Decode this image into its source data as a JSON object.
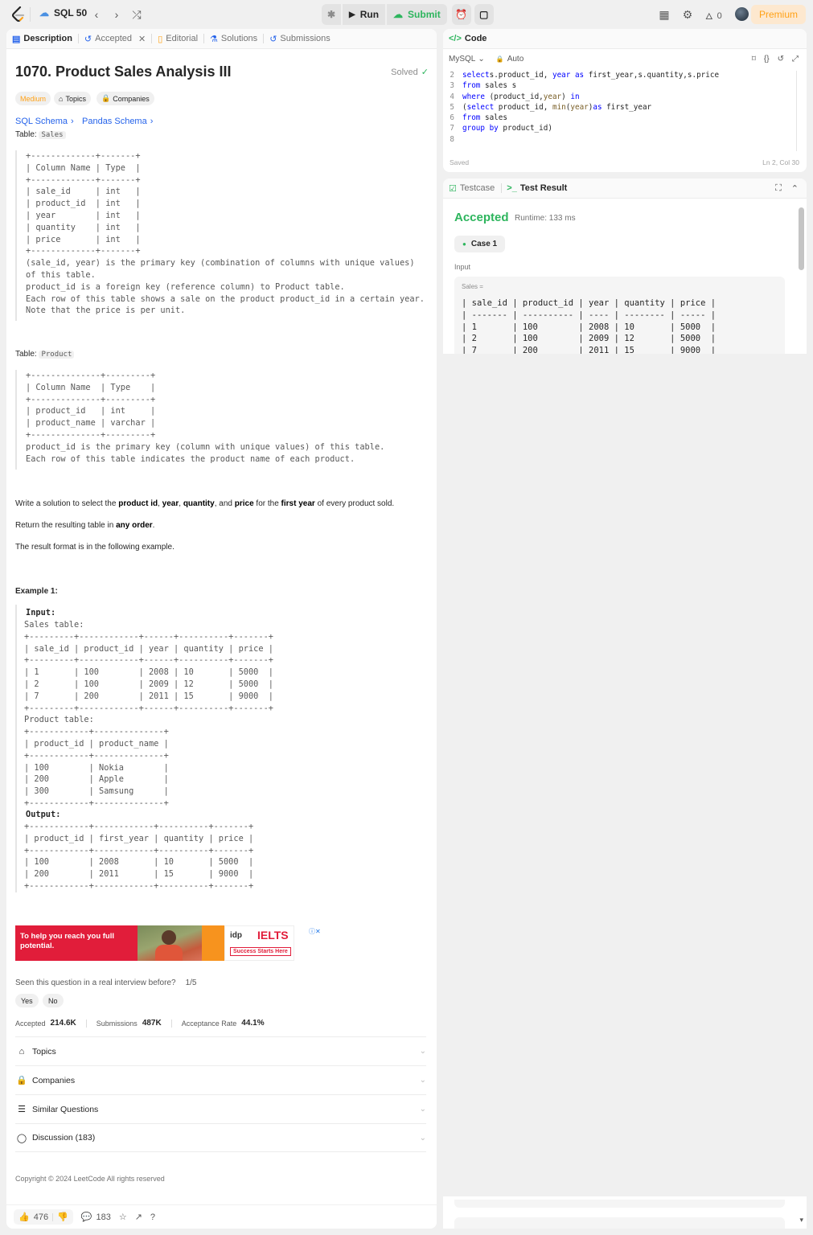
{
  "topbar": {
    "study_plan": "SQL 50",
    "run": "Run",
    "submit": "Submit",
    "streak": "0",
    "premium": "Premium"
  },
  "left_tabs": {
    "description": "Description",
    "accepted": "Accepted",
    "editorial": "Editorial",
    "solutions": "Solutions",
    "submissions": "Submissions"
  },
  "problem": {
    "title": "1070. Product Sales Analysis III",
    "solved": "Solved",
    "difficulty": "Medium",
    "topics_chip": "Topics",
    "companies_chip": "Companies",
    "sql_schema": "SQL Schema",
    "pandas_schema": "Pandas Schema",
    "table_label_1": "Table: ",
    "table_name_1": "Sales",
    "schema_1": "+-------------+-------+\n| Column Name | Type  |\n+-------------+-------+\n| sale_id     | int   |\n| product_id  | int   |\n| year        | int   |\n| quantity    | int   |\n| price       | int   |\n+-------------+-------+\n(sale_id, year) is the primary key (combination of columns with unique values)\nof this table.\nproduct_id is a foreign key (reference column) to Product table.\nEach row of this table shows a sale on the product product_id in a certain year.\nNote that the price is per unit.",
    "table_label_2": "Table: ",
    "table_name_2": "Product",
    "schema_2": "+--------------+---------+\n| Column Name  | Type    |\n+--------------+---------+\n| product_id   | int     |\n| product_name | varchar |\n+--------------+---------+\nproduct_id is the primary key (column with unique values) of this table.\nEach row of this table indicates the product name of each product.",
    "para1_a": "Write a solution to select the ",
    "para1_b": "product id",
    "para1_c": ", ",
    "para1_d": "year",
    "para1_e": ", ",
    "para1_f": "quantity",
    "para1_g": ", and ",
    "para1_h": "price",
    "para1_i": " for the ",
    "para1_j": "first year",
    "para1_k": " of every product sold.",
    "para2_a": "Return the resulting table in ",
    "para2_b": "any order",
    "para2_c": ".",
    "para3": "The result format is in the following example.",
    "example_title": "Example 1:",
    "input_label": "Input:",
    "example_input": "Sales table:\n+---------+------------+------+----------+-------+\n| sale_id | product_id | year | quantity | price |\n+---------+------------+------+----------+-------+\n| 1       | 100        | 2008 | 10       | 5000  |\n| 2       | 100        | 2009 | 12       | 5000  |\n| 7       | 200        | 2011 | 15       | 9000  |\n+---------+------------+------+----------+-------+\nProduct table:\n+------------+--------------+\n| product_id | product_name |\n+------------+--------------+\n| 100        | Nokia        |\n| 200        | Apple        |\n| 300        | Samsung      |\n+------------+--------------+",
    "output_label": "Output:",
    "example_output": "+------------+------------+----------+-------+\n| product_id | first_year | quantity | price |\n+------------+------------+----------+-------+\n| 100        | 2008       | 10       | 5000  |\n| 200        | 2011       | 15       | 9000  |\n+------------+------------+----------+-------+"
  },
  "ad": {
    "headline": "To help you reach you full potential.",
    "brand_idp": "idp",
    "brand_ielts": "IELTS",
    "tagline": "Success Starts Here"
  },
  "interview": {
    "question": "Seen this question in a real interview before?",
    "count": "1/5",
    "yes": "Yes",
    "no": "No"
  },
  "stats": {
    "accepted_label": "Accepted",
    "accepted_value": "214.6K",
    "submissions_label": "Submissions",
    "submissions_value": "487K",
    "rate_label": "Acceptance Rate",
    "rate_value": "44.1%"
  },
  "accordions": [
    "Topics",
    "Companies",
    "Similar Questions",
    "Discussion (183)"
  ],
  "copyright": "Copyright © 2024 LeetCode All rights reserved",
  "bottom_bar": {
    "likes": "476",
    "comments": "183"
  },
  "code_panel": {
    "title": "Code",
    "language": "MySQL",
    "mode": "Auto",
    "saved": "Saved",
    "cursor": "Ln 2, Col 30",
    "lines": [
      {
        "n": "2",
        "segs": [
          [
            "kw",
            "select"
          ],
          [
            "",
            "s.product_id, "
          ],
          [
            "kw",
            "year"
          ],
          [
            "",
            ""
          ],
          [
            "kw",
            " as"
          ],
          [
            "",
            " first_year,s.quantity,s.price"
          ]
        ]
      },
      {
        "n": "3",
        "segs": [
          [
            "kw",
            "from"
          ],
          [
            "",
            " sales s"
          ]
        ]
      },
      {
        "n": "4",
        "segs": [
          [
            "kw",
            "where"
          ],
          [
            "",
            " (product_id,"
          ],
          [
            "fn",
            "year"
          ],
          [
            "",
            ") "
          ],
          [
            "kw",
            "in"
          ]
        ]
      },
      {
        "n": "5",
        "segs": [
          [
            "",
            "("
          ],
          [
            "kw",
            "select"
          ],
          [
            "",
            " product_id, "
          ],
          [
            "fn",
            "min"
          ],
          [
            "",
            "("
          ],
          [
            "fn",
            "year"
          ],
          [
            "",
            ")"
          ],
          [
            "kw",
            "as"
          ],
          [
            "",
            " first_year"
          ]
        ]
      },
      {
        "n": "6",
        "segs": [
          [
            "kw",
            "from"
          ],
          [
            "",
            " sales"
          ]
        ]
      },
      {
        "n": "7",
        "segs": [
          [
            "kw",
            "group by"
          ],
          [
            "",
            " product_id)"
          ]
        ]
      },
      {
        "n": "8",
        "segs": []
      }
    ]
  },
  "result_panel": {
    "testcase": "Testcase",
    "test_result": "Test Result",
    "status": "Accepted",
    "runtime": "Runtime: 133 ms",
    "case": "Case 1",
    "input_label": "Input",
    "sales_label": "Sales =",
    "sales_table": "| sale_id | product_id | year | quantity | price |\n| ------- | ---------- | ---- | -------- | ----- |\n| 1       | 100        | 2008 | 10       | 5000  |\n| 2       | 100        | 2009 | 12       | 5000  |\n| 7       | 200        | 2011 | 15       | 9000  |"
  },
  "colors": {
    "accent_green": "#2db55d",
    "medium": "#ffa116",
    "link_blue": "#2563eb"
  }
}
